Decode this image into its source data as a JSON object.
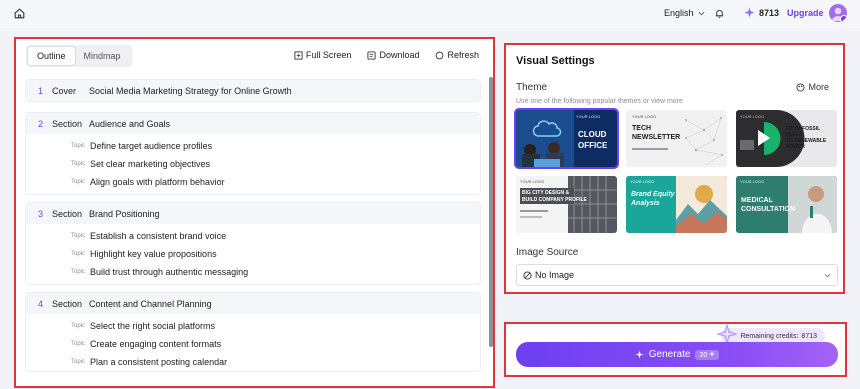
{
  "topbar": {
    "language": "English",
    "credits": "8713",
    "upgrade_label": "Upgrade"
  },
  "outline": {
    "tabs": [
      "Outline",
      "Mindmap"
    ],
    "actions": {
      "fullscreen": "Full Screen",
      "download": "Download",
      "refresh": "Refresh"
    },
    "cover": {
      "num": "1",
      "kind": "Cover",
      "title": "Social Media Marketing Strategy for Online Growth"
    },
    "sections": [
      {
        "num": "2",
        "kind": "Section",
        "title": "Audience and Goals",
        "topics": [
          "Define target audience profiles",
          "Set clear marketing objectives",
          "Align goals with platform behavior"
        ]
      },
      {
        "num": "3",
        "kind": "Section",
        "title": "Brand Positioning",
        "topics": [
          "Establish a consistent brand voice",
          "Highlight key value propositions",
          "Build trust through authentic messaging"
        ]
      },
      {
        "num": "4",
        "kind": "Section",
        "title": "Content and Channel Planning",
        "topics": [
          "Select the right social platforms",
          "Create engaging content formats",
          "Plan a consistent posting calendar"
        ]
      }
    ],
    "topic_tag": "Topic"
  },
  "visual": {
    "title": "Visual Settings",
    "theme_label": "Theme",
    "more_label": "More",
    "theme_hint": "Use one of the following popular themes or view more.",
    "themes": [
      {
        "logo": "YOUR LOGO",
        "lines": [
          "CLOUD",
          "OFFICE"
        ]
      },
      {
        "logo": "YOUR LOGO",
        "lines": [
          "TECH",
          "NEWSLETTER"
        ]
      },
      {
        "logo": "YOUR LOGO",
        "lines": [
          "FROM FOSSIL FUELS",
          "TO RENEWABLE",
          "POWER"
        ]
      },
      {
        "logo": "YOUR LOGO",
        "lines": [
          "BIG CITY DESIGN &",
          "BUILD COMPANY PROFILE"
        ]
      },
      {
        "logo": "YOUR LOGO",
        "lines": [
          "Brand Equity",
          "Analysis"
        ]
      },
      {
        "logo": "YOUR LOGO",
        "lines": [
          "MEDICAL",
          "CONSULTATION"
        ]
      }
    ],
    "image_source_label": "Image Source",
    "image_source_value": "No Image"
  },
  "generate": {
    "remaining_label": "Remaining credits:",
    "remaining_value": "8713",
    "button_label": "Generate",
    "cost": "20"
  },
  "colors": {
    "accent": "#6d3ff0",
    "annotation": "#e2343a"
  }
}
